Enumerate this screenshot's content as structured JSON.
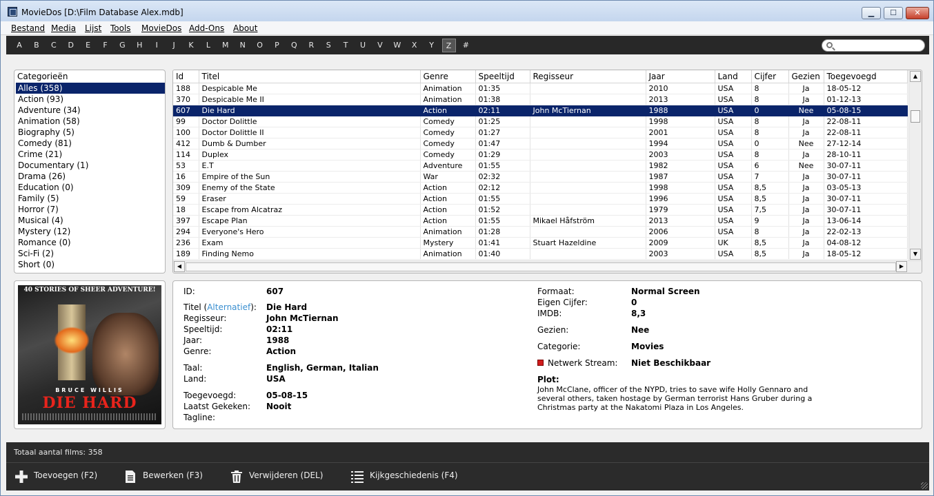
{
  "window": {
    "title": "MovieDos [D:\\Film Database Alex.mdb]",
    "min": "▁",
    "max": "☐",
    "close": "✕"
  },
  "menu": [
    "Bestand",
    "Media",
    "Lijst",
    "Tools",
    "MovieDos",
    "Add-Ons",
    "About"
  ],
  "alphabet": [
    "A",
    "B",
    "C",
    "D",
    "E",
    "F",
    "G",
    "H",
    "I",
    "J",
    "K",
    "L",
    "M",
    "N",
    "O",
    "P",
    "Q",
    "R",
    "S",
    "T",
    "U",
    "V",
    "W",
    "X",
    "Y",
    "Z",
    "#"
  ],
  "alphabet_active": "Z",
  "search": {
    "value": "",
    "placeholder": ""
  },
  "categories": {
    "header": "Categorieën",
    "items": [
      "Alles (358)",
      "Action (93)",
      "Adventure (34)",
      "Animation (58)",
      "Biography (5)",
      "Comedy (81)",
      "Crime (21)",
      "Documentary (1)",
      "Drama (26)",
      "Education (0)",
      "Family (5)",
      "Horror (7)",
      "Musical (4)",
      "Mystery (12)",
      "Romance (0)",
      "Sci-Fi (2)",
      "Short (0)"
    ],
    "selected": 0
  },
  "grid": {
    "columns": [
      "Id",
      "Titel",
      "Genre",
      "Speeltijd",
      "Regisseur",
      "Jaar",
      "Land",
      "Cijfer",
      "Gezien",
      "Toegevoegd"
    ],
    "rows": [
      [
        "188",
        "Despicable Me",
        "Animation",
        "01:35",
        "",
        "2010",
        "USA",
        "8",
        "Ja",
        "18-05-12"
      ],
      [
        "370",
        "Despicable Me II",
        "Animation",
        "01:38",
        "",
        "2013",
        "USA",
        "8",
        "Ja",
        "01-12-13"
      ],
      [
        "607",
        "Die Hard",
        "Action",
        "02:11",
        "John McTiernan",
        "1988",
        "USA",
        "0",
        "Nee",
        "05-08-15"
      ],
      [
        "99",
        "Doctor Dolittle",
        "Comedy",
        "01:25",
        "",
        "1998",
        "USA",
        "8",
        "Ja",
        "22-08-11"
      ],
      [
        "100",
        "Doctor Dolittle II",
        "Comedy",
        "01:27",
        "",
        "2001",
        "USA",
        "8",
        "Ja",
        "22-08-11"
      ],
      [
        "412",
        "Dumb & Dumber",
        "Comedy",
        "01:47",
        "",
        "1994",
        "USA",
        "0",
        "Nee",
        "27-12-14"
      ],
      [
        "114",
        "Duplex",
        "Comedy",
        "01:29",
        "",
        "2003",
        "USA",
        "8",
        "Ja",
        "28-10-11"
      ],
      [
        "53",
        "E.T",
        "Adventure",
        "01:55",
        "",
        "1982",
        "USA",
        "6",
        "Nee",
        "30-07-11"
      ],
      [
        "16",
        "Empire of the Sun",
        "War",
        "02:32",
        "",
        "1987",
        "USA",
        "7",
        "Ja",
        "30-07-11"
      ],
      [
        "309",
        "Enemy of the State",
        "Action",
        "02:12",
        "",
        "1998",
        "USA",
        "8,5",
        "Ja",
        "03-05-13"
      ],
      [
        "59",
        "Eraser",
        "Action",
        "01:55",
        "",
        "1996",
        "USA",
        "8,5",
        "Ja",
        "30-07-11"
      ],
      [
        "18",
        "Escape from Alcatraz",
        "Action",
        "01:52",
        "",
        "1979",
        "USA",
        "7,5",
        "Ja",
        "30-07-11"
      ],
      [
        "397",
        "Escape Plan",
        "Action",
        "01:55",
        "Mikael Håfström",
        "2013",
        "USA",
        "9",
        "Ja",
        "13-06-14"
      ],
      [
        "294",
        "Everyone's Hero",
        "Animation",
        "01:28",
        "",
        "2006",
        "USA",
        "8",
        "Ja",
        "22-02-13"
      ],
      [
        "236",
        "Exam",
        "Mystery",
        "01:41",
        "Stuart Hazeldine",
        "2009",
        "UK",
        "8,5",
        "Ja",
        "04-08-12"
      ],
      [
        "189",
        "Finding Nemo",
        "Animation",
        "01:40",
        "",
        "2003",
        "USA",
        "8,5",
        "Ja",
        "18-05-12"
      ]
    ],
    "selected_row": 2
  },
  "poster": {
    "tagline_top": "40 STORIES OF SHEER ADVENTURE!",
    "actor": "BRUCE WILLIS",
    "title": "DIE HARD"
  },
  "details": {
    "id_label": "ID:",
    "id": "607",
    "title_label_pre": "Titel (",
    "title_label_link": "Alternatief",
    "title_label_post": "):",
    "title": "Die Hard",
    "director_label": "Regisseur:",
    "director": "John McTiernan",
    "runtime_label": "Speeltijd:",
    "runtime": "02:11",
    "year_label": "Jaar:",
    "year": "1988",
    "genre_label": "Genre:",
    "genre": "Action",
    "language_label": "Taal:",
    "language": "English, German, Italian",
    "country_label": "Land:",
    "country": "USA",
    "added_label": "Toegevoegd:",
    "added": "05-08-15",
    "last_watched_label": "Laatst Gekeken:",
    "last_watched": "Nooit",
    "tagline_label": "Tagline:",
    "tagline": "",
    "format_label": "Formaat:",
    "format": "Normal Screen",
    "own_rating_label": "Eigen Cijfer:",
    "own_rating": "0",
    "imdb_label": "IMDB:",
    "imdb": "8,3",
    "seen_label": "Gezien:",
    "seen": "Nee",
    "category_label": "Categorie:",
    "category": "Movies",
    "stream_label": "Netwerk Stream:",
    "stream": "Niet Beschikbaar",
    "stream_color": "#d01c1c",
    "plot_label": "Plot:",
    "plot": "John McClane, officer of the NYPD, tries to save wife Holly Gennaro and several others, taken hostage by German terrorist Hans Gruber during a Christmas party at the Nakatomi Plaza in Los Angeles."
  },
  "status": {
    "total": "Totaal aantal films: 358"
  },
  "actions": [
    {
      "label": "Toevoegen (F2)",
      "icon": "plus-icon"
    },
    {
      "label": "Bewerken (F3)",
      "icon": "document-icon"
    },
    {
      "label": "Verwijderen (DEL)",
      "icon": "trash-icon"
    },
    {
      "label": "Kijkgeschiedenis (F4)",
      "icon": "list-icon"
    }
  ],
  "colors": {
    "selection": "#0a246a",
    "bar": "#2b2b2b",
    "link": "#3a8fd0"
  }
}
